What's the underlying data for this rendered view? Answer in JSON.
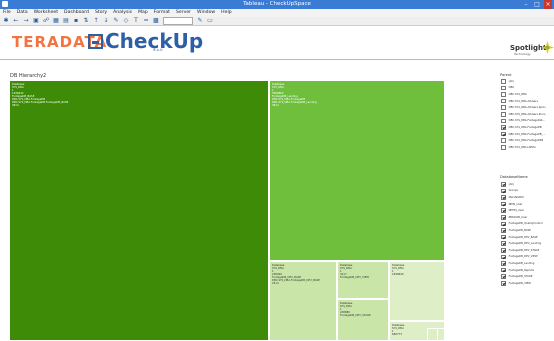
{
  "window": {
    "title": "Tableau - CheckUpSpace"
  },
  "menu": [
    "File",
    "Data",
    "Worksheet",
    "Dashboard",
    "Story",
    "Analysis",
    "Map",
    "Format",
    "Server",
    "Window",
    "Help"
  ],
  "header": {
    "brand_left": "TERADATA",
    "brand_main": "CheckUp",
    "brand_ver": "9.x.0",
    "partner": "Spotlight",
    "partner_sub": "Technology"
  },
  "viz": {
    "title": "DB Hierarchy2",
    "cells": [
      {
        "tone": "dk",
        "lines": [
          "Database",
          "SYS_DBA",
          "1",
          "1298432",
          "FootageDB_BASE",
          "DBC.SYS_DBA.FootageDB",
          "DBC.SYS_DBA.FootageDB.FootageDB_BASE",
          "3814"
        ]
      },
      {
        "tone": "md",
        "lines": [
          "Database",
          "SYS_DBA",
          "1",
          "5898864",
          "FootageDB_Landing",
          "DBC.SYS_DBA.FootageDB",
          "DBC.SYS_DBA.FootageDB_Landing",
          "3814"
        ]
      },
      {
        "tone": "lt",
        "lines": [
          "Database",
          "SYS_DBA",
          "1",
          "248920",
          "FootageDB_DEV_BASE",
          "DBC.SYS_DBA.FootageDB_DEV_BASE",
          "2314"
        ]
      },
      {
        "tone": "lt",
        "lines": [
          "Database",
          "SYS_DBA",
          "1",
          "3217",
          "FootageDB_DEV_VIEW"
        ]
      },
      {
        "tone": "lt",
        "lines": [
          "Database",
          "SYS_DBA",
          "1",
          "1698640"
        ]
      },
      {
        "tone": "lt",
        "lines": [
          "Database",
          "SYS_DBA",
          "1",
          "248880",
          "FootageDB_DEV_STAGE"
        ]
      },
      {
        "tone": "lt",
        "lines": [
          "Database",
          "SYS_DBA",
          "1",
          "668773"
        ]
      }
    ]
  },
  "filters": {
    "parent": {
      "label": "Parent",
      "items": [
        {
          "label": "(All)",
          "checked": false
        },
        {
          "label": "DBC",
          "checked": false
        },
        {
          "label": "DBC.SYS_DBA",
          "checked": false
        },
        {
          "label": "DBC.SYS_DBA.AllUsers",
          "checked": false
        },
        {
          "label": "DBC.SYS_DBA.AllUsers.Spot...",
          "checked": false
        },
        {
          "label": "DBC.SYS_DBA.AllUsers.Prod...",
          "checked": false
        },
        {
          "label": "DBC.SYS_DBA.FootageDat...",
          "checked": false
        },
        {
          "label": "DBC.SYS_DBA.FootageDB",
          "checked": true
        },
        {
          "label": "DBC.SYS_DBA.FootageDB_...",
          "checked": true
        },
        {
          "label": "DBC.SYS_DBA.FootageDB2",
          "checked": false
        },
        {
          "label": "DBC.SYS_DBA.LSPPix",
          "checked": false
        }
      ]
    },
    "databases": {
      "label": "DatabaseName",
      "items": [
        {
          "label": "(All)",
          "checked": true
        },
        {
          "label": "Groups",
          "checked": true
        },
        {
          "label": "MarsStatDS",
          "checked": true
        },
        {
          "label": "NIMS_User",
          "checked": true
        },
        {
          "label": "NMITS_User",
          "checked": true
        },
        {
          "label": "PBS2000_User",
          "checked": true
        },
        {
          "label": "FootageDB_QualityControl",
          "checked": true
        },
        {
          "label": "FootageDB_BASE",
          "checked": true
        },
        {
          "label": "FootageDB_DEV_BASE",
          "checked": true
        },
        {
          "label": "FootageDB_DEV_Landing",
          "checked": true
        },
        {
          "label": "FootageDB_DEV_STAGE",
          "checked": true
        },
        {
          "label": "FootageDB_DEV_VIEW",
          "checked": true
        },
        {
          "label": "FootageDB_Landing",
          "checked": true
        },
        {
          "label": "FootageDB_Reports",
          "checked": true
        },
        {
          "label": "FootageDB_STAGE",
          "checked": true
        },
        {
          "label": "FootageDB_VIEW",
          "checked": true
        }
      ]
    }
  },
  "colors": {
    "dark_green": "#3d8b06",
    "mid_green": "#6fbf3d",
    "light_green": "#c9e6a8",
    "pale_green": "#deefc8"
  }
}
